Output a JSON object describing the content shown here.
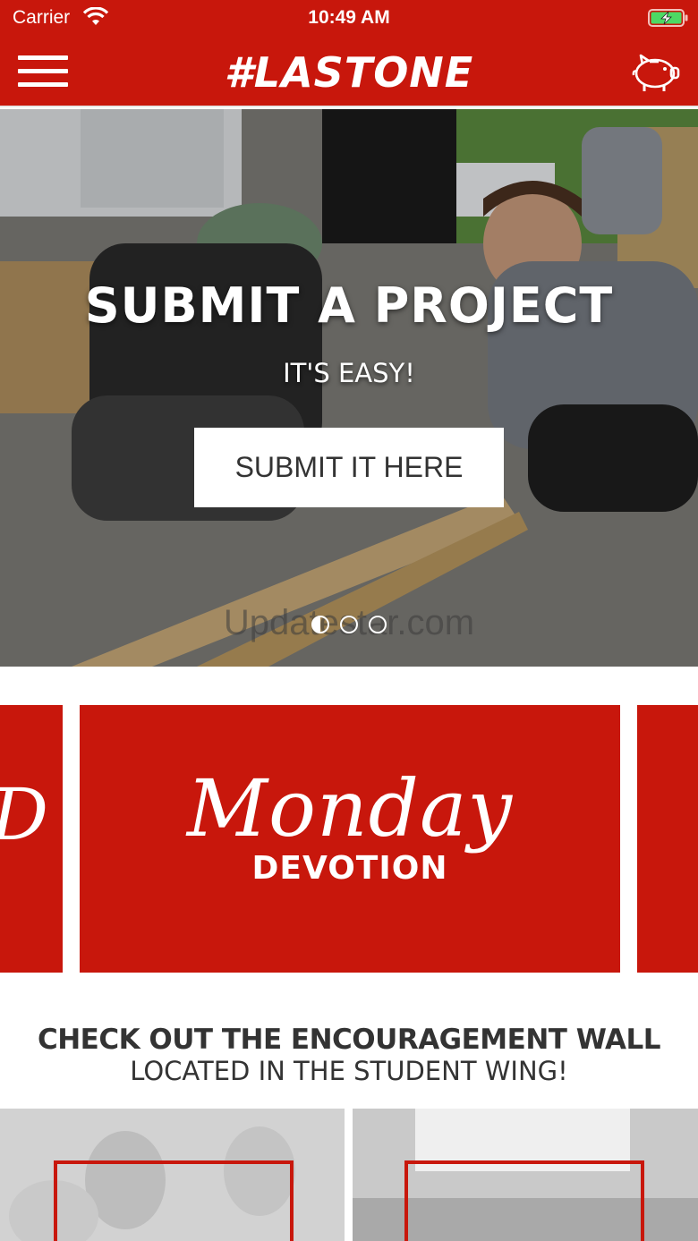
{
  "status_bar": {
    "carrier": "Carrier",
    "time": "10:49 AM",
    "wifi_icon": "wifi-icon",
    "battery_icon": "battery-charging-icon"
  },
  "nav": {
    "title": "#LASTONE",
    "menu_icon": "hamburger-menu-icon",
    "piggy_icon": "piggy-bank-icon",
    "background_color": "#c8170c"
  },
  "hero": {
    "title": "SUBMIT A PROJECT",
    "subtitle": "IT'S EASY!",
    "button_label": "SUBMIT IT HERE",
    "watermark": "Updatestar.com",
    "page_count": 3,
    "active_page": 1
  },
  "cards": {
    "left_partial_text": "D",
    "main_script": "Monday",
    "main_caption": "DEVOTION",
    "color": "#c8170c"
  },
  "encouragement": {
    "line1": "CHECK OUT THE ENCOURAGEMENT WALL",
    "line2": "LOCATED IN THE STUDENT WING!"
  }
}
